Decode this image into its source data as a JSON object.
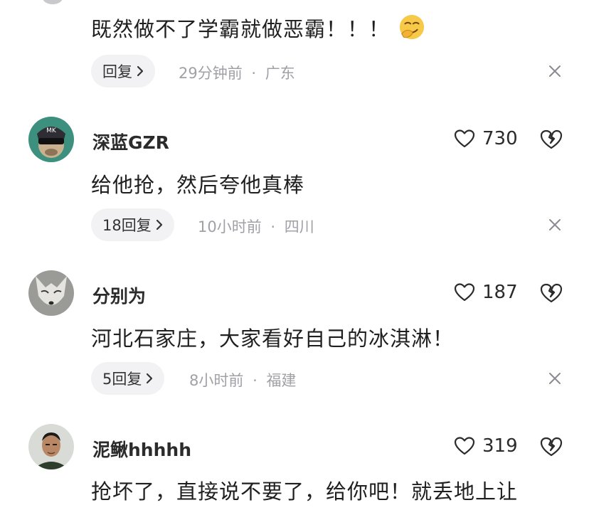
{
  "comments": [
    {
      "text": "既然做不了学霸就做恶霸！！！",
      "emoji": "smirk-emoji",
      "reply_label": "回复",
      "time": "29分钟前",
      "location": "广东"
    },
    {
      "username": "深蓝GZR",
      "likes": "730",
      "text": "给他抢，然后夸他真棒",
      "reply_label": "18回复",
      "time": "10小时前",
      "location": "四川"
    },
    {
      "username": "分别为",
      "likes": "187",
      "text": "河北石家庄，大家看好自己的冰淇淋！",
      "reply_label": "5回复",
      "time": "8小时前",
      "location": "福建"
    },
    {
      "username": "泥鳅hhhhh",
      "likes": "319",
      "text": "抢坏了，直接说不要了，给你吧！就丢地上让"
    }
  ],
  "separator": "·",
  "colors": {
    "text": "#1f1f1f",
    "meta": "#a0a0a6",
    "pill_bg": "#f2f2f4"
  }
}
